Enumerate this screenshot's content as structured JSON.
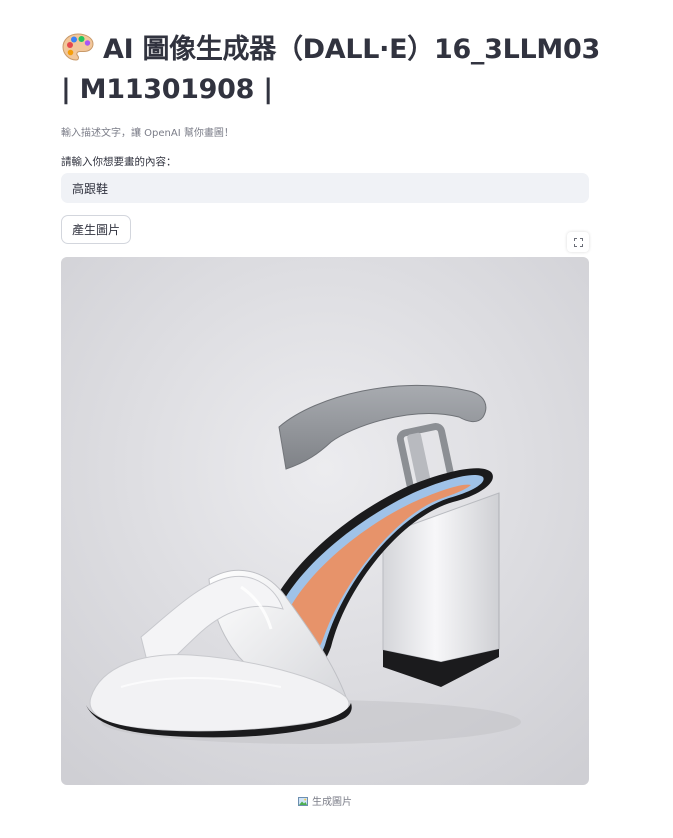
{
  "header": {
    "title": "AI 圖像生成器（DALL·E）16_3LLM03 | M11301908 |",
    "title_icon": "artist-palette-icon",
    "caption": "輸入描述文字，讓 OpenAI 幫你畫圖！"
  },
  "form": {
    "prompt_label": "請輸入你想要畫的內容：",
    "prompt_value": "高跟鞋",
    "submit_label": "產生圖片"
  },
  "image": {
    "fullscreen_icon": "expand-icon",
    "caption": "生成圖片",
    "caption_icon": "image-icon",
    "colors": {
      "background": "#d9d9dd",
      "strap": "#8f9296",
      "insole": "#e7936a",
      "insole_edge": "#9fc2e8",
      "shoe_body": "#f1f1f3",
      "sole": "#1b1b1d"
    }
  }
}
